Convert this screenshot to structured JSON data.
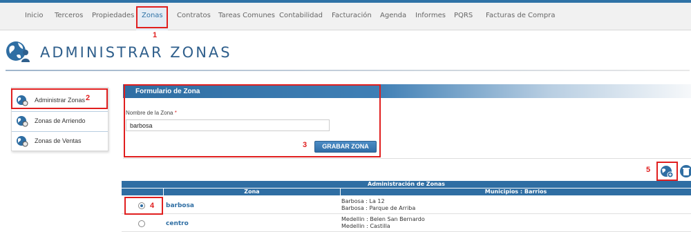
{
  "nav": {
    "items": [
      "Inicio",
      "Terceros",
      "Propiedades",
      "Zonas",
      "Contratos",
      "Tareas Comunes",
      "Contabilidad",
      "Facturación",
      "Agenda",
      "Informes",
      "PQRS",
      "Facturas de Compra"
    ]
  },
  "page": {
    "title": "ADMINISTRAR ZONAS"
  },
  "sidebar": {
    "items": [
      {
        "label": "Administrar Zonas",
        "icon": "globe-settings-icon"
      },
      {
        "label": "Zonas de Arriendo",
        "icon": "globe-arrow-icon"
      },
      {
        "label": "Zonas de Ventas",
        "icon": "globe-dollar-icon"
      }
    ]
  },
  "form": {
    "header": "Formulario de Zona",
    "field_label": "Nombre de la Zona",
    "required_mark": "*",
    "field_value": "barbosa",
    "submit_label": "GRABAR ZONA"
  },
  "table": {
    "title": "Administración de Zonas",
    "columns": [
      "Zona",
      "Municipios : Barrios"
    ],
    "rows": [
      {
        "selected": true,
        "zona": "barbosa",
        "municipios": [
          "Barbosa : La 12",
          "Barbosa : Parque de Arriba"
        ]
      },
      {
        "selected": false,
        "zona": "centro",
        "municipios": [
          "Medellin : Belen San Bernardo",
          "Medellin : Castilla"
        ]
      }
    ]
  },
  "markers": [
    "1",
    "2",
    "3",
    "4",
    "5"
  ],
  "colors": {
    "accent": "#2f6ea3",
    "highlight": "#e01e1e",
    "title": "#2f5f8c"
  }
}
